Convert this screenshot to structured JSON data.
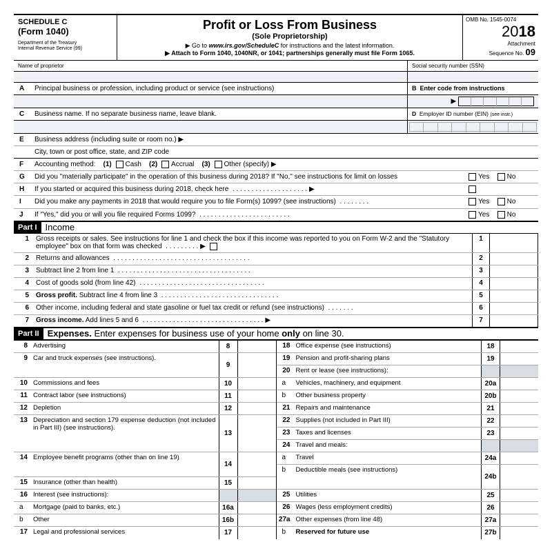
{
  "header": {
    "schedule": "SCHEDULE C",
    "form": "(Form 1040)",
    "dept1": "Department of the Treasury",
    "dept2": "Internal Revenue Service (99)",
    "title": "Profit or Loss From Business",
    "subtitle": "(Sole Proprietorship)",
    "goto_pre": "▶ Go to ",
    "goto_url": "www.irs.gov/ScheduleC",
    "goto_post": " for instructions and the latest information.",
    "attach": "▶ Attach to Form 1040, 1040NR, or 1041; partnerships generally must file Form 1065.",
    "omb": "OMB No. 1545-0074",
    "year_prefix": "20",
    "year_suffix": "18",
    "attachment": "Attachment",
    "seq_label": "Sequence No. ",
    "seq_no": "09"
  },
  "top": {
    "name_label": "Name of proprietor",
    "ssn_label": "Social security number (SSN)",
    "A": "Principal business or profession, including product or service (see instructions)",
    "B": "Enter code from instructions",
    "C": "Business name. If no separate business name, leave blank.",
    "D_pre": "Employer ID number (EIN) ",
    "D_small": "(see instr.)",
    "E1": "Business address (including suite or room no.) ▶",
    "E2": "City, town or post office, state, and ZIP code",
    "F_label": "Accounting method:",
    "F_1": "(1)",
    "F_1t": "Cash",
    "F_2": "(2)",
    "F_2t": "Accrual",
    "F_3": "(3)",
    "F_3t": "Other (specify) ▶",
    "G": "Did you \"materially participate\" in the operation of this business during 2018? If \"No,\" see instructions for limit on losses",
    "H": "If you started or acquired this business during 2018, check here",
    "I": "Did you make any payments in 2018 that would require you to file Form(s) 1099? (see instructions)",
    "J": "If \"Yes,\" did you or will you file required Forms 1099?",
    "yes": "Yes",
    "no": "No"
  },
  "part1": {
    "badge": "Part I",
    "title": "Income",
    "lines": {
      "1": "Gross receipts or sales. See instructions for line 1 and check the box if this income was reported to you on Form W-2 and the \"Statutory employee\" box on that form was checked",
      "2": "Returns and allowances",
      "3": "Subtract line 2 from line 1",
      "4": "Cost of goods sold (from line 42)",
      "5_pre": "Gross profit.",
      "5_post": "  Subtract line 4 from line 3",
      "6": "Other income, including federal and state gasoline or fuel tax credit or refund (see instructions)",
      "7_pre": "Gross income.",
      "7_post": "  Add lines 5 and 6"
    }
  },
  "part2": {
    "badge": "Part II",
    "title_pre": "Expenses.",
    "title_post": " Enter expenses for business use of your home ",
    "title_bold": "only",
    "title_end": " on line 30.",
    "left": [
      {
        "n": "8",
        "d": "Advertising",
        "b": "8"
      },
      {
        "n": "9",
        "d": "Car and truck expenses (see instructions).",
        "b": "9",
        "tall": true
      },
      {
        "n": "10",
        "d": "Commissions and fees",
        "b": "10"
      },
      {
        "n": "11",
        "d": "Contract labor (see instructions)",
        "b": "11"
      },
      {
        "n": "12",
        "d": "Depletion",
        "b": "12"
      },
      {
        "n": "13",
        "d": "Depreciation and section 179 expense deduction (not included in Part III) (see instructions).",
        "b": "13",
        "tall3": true
      },
      {
        "n": "14",
        "d": "Employee benefit programs (other than on line 19)",
        "b": "14",
        "tall": true
      },
      {
        "n": "15",
        "d": "Insurance (other than health)",
        "b": "15"
      },
      {
        "n": "16",
        "d": "Interest (see instructions):",
        "nobox": true
      },
      {
        "n": "a",
        "d": "Mortgage (paid to banks, etc.)",
        "b": "16a",
        "sub": true
      },
      {
        "n": "b",
        "d": "Other",
        "b": "16b",
        "sub": true
      },
      {
        "n": "17",
        "d": "Legal and professional services",
        "b": "17",
        "last": true
      }
    ],
    "right": [
      {
        "n": "18",
        "d": "Office expense (see instructions)",
        "b": "18"
      },
      {
        "n": "19",
        "d": "Pension and profit-sharing plans",
        "b": "19"
      },
      {
        "n": "20",
        "d": "Rent or lease (see instructions):",
        "nobox": true
      },
      {
        "n": "a",
        "d": "Vehicles, machinery, and equipment",
        "b": "20a",
        "sub": true
      },
      {
        "n": "b",
        "d": "Other business property",
        "b": "20b",
        "sub": true
      },
      {
        "n": "21",
        "d": "Repairs and maintenance",
        "b": "21"
      },
      {
        "n": "22",
        "d": "Supplies (not included in Part III)",
        "b": "22"
      },
      {
        "n": "23",
        "d": "Taxes and licenses",
        "b": "23"
      },
      {
        "n": "24",
        "d": "Travel and meals:",
        "nobox": true
      },
      {
        "n": "a",
        "d": "Travel",
        "b": "24a",
        "sub": true
      },
      {
        "n": "b",
        "d": "Deductible meals (see instructions)",
        "b": "24b",
        "sub": true,
        "tall": true
      },
      {
        "n": "25",
        "d": "Utilities",
        "b": "25"
      },
      {
        "n": "26",
        "d": "Wages (less employment credits)",
        "b": "26"
      },
      {
        "n": "27a",
        "d": "Other expenses (from line 48)",
        "b": "27a"
      },
      {
        "n": "b",
        "d": "Reserved for future use",
        "b": "27b",
        "sub": true,
        "bold": true,
        "last": true
      }
    ]
  }
}
